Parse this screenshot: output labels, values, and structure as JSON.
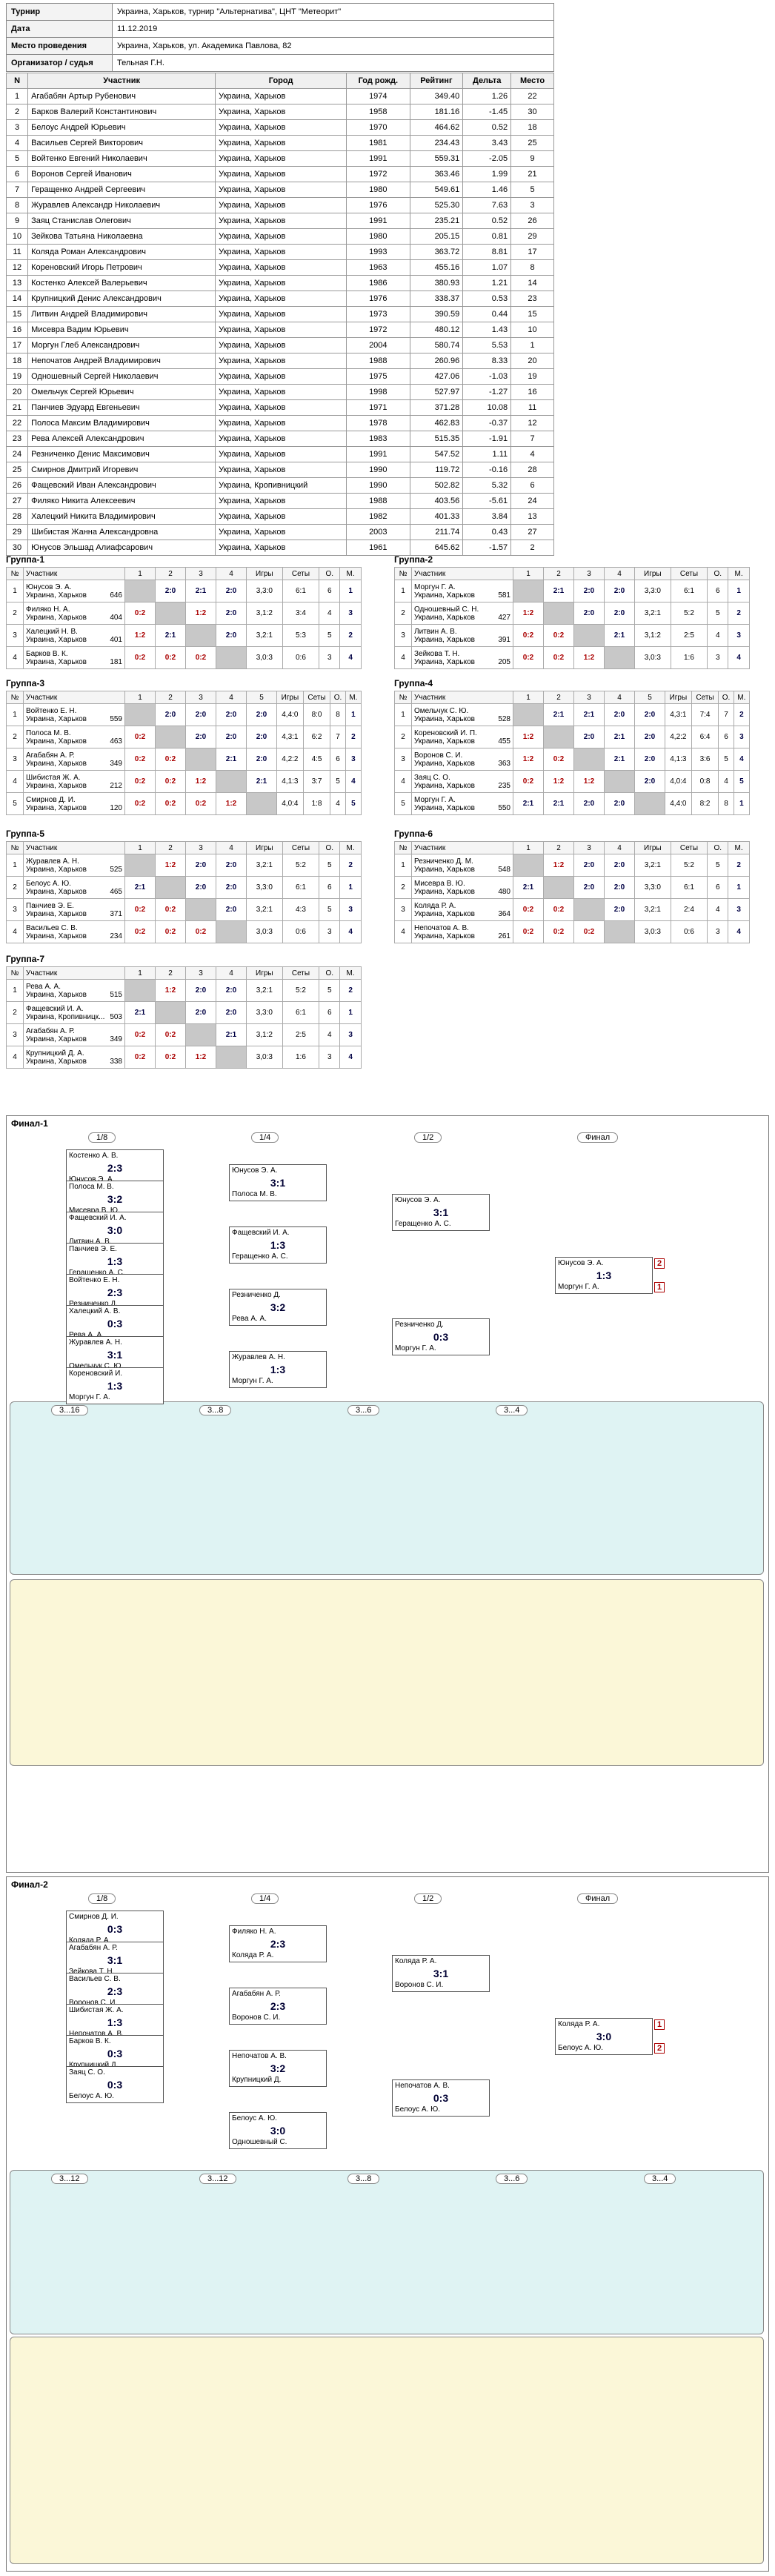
{
  "info": [
    [
      "Турнир",
      "Украина, Харьков, турнир \"Альтернатива\", ЦНТ \"Метеорит\""
    ],
    [
      "Дата",
      "11.12.2019"
    ],
    [
      "Место проведения",
      "Украина, Харьков, ул. Академика Павлова, 82"
    ],
    [
      "Организатор / судья",
      "Тельная Г.Н."
    ]
  ],
  "players_headers": [
    "N",
    "Участник",
    "Город",
    "Год рожд.",
    "Рейтинг",
    "Дельта",
    "Место"
  ],
  "players": [
    [
      "1",
      "Агабабян Артыр Рубенович",
      "Украина, Харьков",
      "1974",
      "349.40",
      "1.26",
      "22"
    ],
    [
      "2",
      "Барков Валерий Константинович",
      "Украина, Харьков",
      "1958",
      "181.16",
      "-1.45",
      "30"
    ],
    [
      "3",
      "Белоус Андрей Юрьевич",
      "Украина, Харьков",
      "1970",
      "464.62",
      "0.52",
      "18"
    ],
    [
      "4",
      "Васильев Сергей Викторович",
      "Украина, Харьков",
      "1981",
      "234.43",
      "3.43",
      "25"
    ],
    [
      "5",
      "Войтенко Евгений Николаевич",
      "Украина, Харьков",
      "1991",
      "559.31",
      "-2.05",
      "9"
    ],
    [
      "6",
      "Воронов Сергей Иванович",
      "Украина, Харьков",
      "1972",
      "363.46",
      "1.99",
      "21"
    ],
    [
      "7",
      "Геращенко Андрей Сергеевич",
      "Украина, Харьков",
      "1980",
      "549.61",
      "1.46",
      "5"
    ],
    [
      "8",
      "Журавлев Александр Николаевич",
      "Украина, Харьков",
      "1976",
      "525.30",
      "7.63",
      "3"
    ],
    [
      "9",
      "Заяц Станислав Олегович",
      "Украина, Харьков",
      "1991",
      "235.21",
      "0.52",
      "26"
    ],
    [
      "10",
      "Зейкова Татьяна Николаевна",
      "Украина, Харьков",
      "1980",
      "205.15",
      "0.81",
      "29"
    ],
    [
      "11",
      "Коляда Роман Александрович",
      "Украина, Харьков",
      "1993",
      "363.72",
      "8.81",
      "17"
    ],
    [
      "12",
      "Кореновский Игорь Петрович",
      "Украина, Харьков",
      "1963",
      "455.16",
      "1.07",
      "8"
    ],
    [
      "13",
      "Костенко Алексей Валерьевич",
      "Украина, Харьков",
      "1986",
      "380.93",
      "1.21",
      "14"
    ],
    [
      "14",
      "Крупницкий Денис Александрович",
      "Украина, Харьков",
      "1976",
      "338.37",
      "0.53",
      "23"
    ],
    [
      "15",
      "Литвин Андрей Владимирович",
      "Украина, Харьков",
      "1973",
      "390.59",
      "0.44",
      "15"
    ],
    [
      "16",
      "Мисевра Вадим Юрьевич",
      "Украина, Харьков",
      "1972",
      "480.12",
      "1.43",
      "10"
    ],
    [
      "17",
      "Моргун Глеб Александрович",
      "Украина, Харьков",
      "2004",
      "580.74",
      "5.53",
      "1"
    ],
    [
      "18",
      "Непочатов Андрей Владимирович",
      "Украина, Харьков",
      "1988",
      "260.96",
      "8.33",
      "20"
    ],
    [
      "19",
      "Одношевный Сергей Николаевич",
      "Украина, Харьков",
      "1975",
      "427.06",
      "-1.03",
      "19"
    ],
    [
      "20",
      "Омельчук Сергей Юрьевич",
      "Украина, Харьков",
      "1998",
      "527.97",
      "-1.27",
      "16"
    ],
    [
      "21",
      "Панчиев Эдуард Евгеньевич",
      "Украина, Харьков",
      "1971",
      "371.28",
      "10.08",
      "11"
    ],
    [
      "22",
      "Полоса Максим Владимирович",
      "Украина, Харьков",
      "1978",
      "462.83",
      "-0.37",
      "12"
    ],
    [
      "23",
      "Рева Алексей Александрович",
      "Украина, Харьков",
      "1983",
      "515.35",
      "-1.91",
      "7"
    ],
    [
      "24",
      "Резниченко Денис Максимович",
      "Украина, Харьков",
      "1991",
      "547.52",
      "1.11",
      "4"
    ],
    [
      "25",
      "Смирнов Дмитрий Игоревич",
      "Украина, Харьков",
      "1990",
      "119.72",
      "-0.16",
      "28"
    ],
    [
      "26",
      "Фащевский Иван Александрович",
      "Украина, Кропивницкий",
      "1990",
      "502.82",
      "5.32",
      "6"
    ],
    [
      "27",
      "Филяко Никита Алексеевич",
      "Украина, Харьков",
      "1988",
      "403.56",
      "-5.61",
      "24"
    ],
    [
      "28",
      "Халецкий Никита Владимирович",
      "Украина, Харьков",
      "1982",
      "401.33",
      "3.84",
      "13"
    ],
    [
      "29",
      "Шибистая Жанна Александровна",
      "Украина, Харьков",
      "2003",
      "211.74",
      "0.43",
      "27"
    ],
    [
      "30",
      "Юнусов Эльшад Алиафсарович",
      "Украина, Харьков",
      "1961",
      "645.62",
      "-1.57",
      "2"
    ]
  ],
  "group_headers": {
    "n": "№",
    "name": "Участник",
    "games": "Игры",
    "sets": "Сеты",
    "o": "О.",
    "m": "М."
  },
  "groups": [
    {
      "title": "Группа-1",
      "size": 4,
      "rows": [
        {
          "n": "1",
          "name": "Юнусов Э. А.",
          "city": "Украина, Харьков",
          "rating": "646",
          "scores": [
            "",
            "2:0",
            "2:1",
            "2:0"
          ],
          "games": "3,3:0",
          "sets": "6:1",
          "o": "6",
          "m": "1"
        },
        {
          "n": "2",
          "name": "Филяко Н. А.",
          "city": "Украина, Харьков",
          "rating": "404",
          "scores": [
            "0:2",
            "",
            "1:2",
            "2:0"
          ],
          "games": "3,1:2",
          "sets": "3:4",
          "o": "4",
          "m": "3"
        },
        {
          "n": "3",
          "name": "Халецкий Н. В.",
          "city": "Украина, Харьков",
          "rating": "401",
          "scores": [
            "1:2",
            "2:1",
            "",
            "2:0"
          ],
          "games": "3,2:1",
          "sets": "5:3",
          "o": "5",
          "m": "2"
        },
        {
          "n": "4",
          "name": "Барков В. К.",
          "city": "Украина, Харьков",
          "rating": "181",
          "scores": [
            "0:2",
            "0:2",
            "0:2",
            ""
          ],
          "games": "3,0:3",
          "sets": "0:6",
          "o": "3",
          "m": "4"
        }
      ]
    },
    {
      "title": "Группа-2",
      "size": 4,
      "rows": [
        {
          "n": "1",
          "name": "Моргун Г. А.",
          "city": "Украина, Харьков",
          "rating": "581",
          "scores": [
            "",
            "2:1",
            "2:0",
            "2:0"
          ],
          "games": "3,3:0",
          "sets": "6:1",
          "o": "6",
          "m": "1"
        },
        {
          "n": "2",
          "name": "Одношевный С. Н.",
          "city": "Украина, Харьков",
          "rating": "427",
          "scores": [
            "1:2",
            "",
            "2:0",
            "2:0"
          ],
          "games": "3,2:1",
          "sets": "5:2",
          "o": "5",
          "m": "2"
        },
        {
          "n": "3",
          "name": "Литвин А. В.",
          "city": "Украина, Харьков",
          "rating": "391",
          "scores": [
            "0:2",
            "0:2",
            "",
            "2:1"
          ],
          "games": "3,1:2",
          "sets": "2:5",
          "o": "4",
          "m": "3"
        },
        {
          "n": "4",
          "name": "Зейкова Т. Н.",
          "city": "Украина, Харьков",
          "rating": "205",
          "scores": [
            "0:2",
            "0:2",
            "1:2",
            ""
          ],
          "games": "3,0:3",
          "sets": "1:6",
          "o": "3",
          "m": "4"
        }
      ]
    },
    {
      "title": "Группа-3",
      "size": 5,
      "rows": [
        {
          "n": "1",
          "name": "Войтенко Е. Н.",
          "city": "Украина, Харьков",
          "rating": "559",
          "scores": [
            "",
            "2:0",
            "2:0",
            "2:0",
            "2:0"
          ],
          "games": "4,4:0",
          "sets": "8:0",
          "o": "8",
          "m": "1"
        },
        {
          "n": "2",
          "name": "Полоса М. В.",
          "city": "Украина, Харьков",
          "rating": "463",
          "scores": [
            "0:2",
            "",
            "2:0",
            "2:0",
            "2:0"
          ],
          "games": "4,3:1",
          "sets": "6:2",
          "o": "7",
          "m": "2"
        },
        {
          "n": "3",
          "name": "Агабабян А. Р.",
          "city": "Украина, Харьков",
          "rating": "349",
          "scores": [
            "0:2",
            "0:2",
            "",
            "2:1",
            "2:0"
          ],
          "games": "4,2:2",
          "sets": "4:5",
          "o": "6",
          "m": "3"
        },
        {
          "n": "4",
          "name": "Шибистая Ж. А.",
          "city": "Украина, Харьков",
          "rating": "212",
          "scores": [
            "0:2",
            "0:2",
            "1:2",
            "",
            "2:1"
          ],
          "games": "4,1:3",
          "sets": "3:7",
          "o": "5",
          "m": "4"
        },
        {
          "n": "5",
          "name": "Смирнов Д. И.",
          "city": "Украина, Харьков",
          "rating": "120",
          "scores": [
            "0:2",
            "0:2",
            "0:2",
            "1:2",
            ""
          ],
          "games": "4,0:4",
          "sets": "1:8",
          "o": "4",
          "m": "5"
        }
      ]
    },
    {
      "title": "Группа-4",
      "size": 5,
      "rows": [
        {
          "n": "1",
          "name": "Омельчук С. Ю.",
          "city": "Украина, Харьков",
          "rating": "528",
          "scores": [
            "",
            "2:1",
            "2:1",
            "2:0",
            "2:0"
          ],
          "games": "4,3:1",
          "sets": "7:4",
          "o": "7",
          "m": "2"
        },
        {
          "n": "2",
          "name": "Кореновский И. П.",
          "city": "Украина, Харьков",
          "rating": "455",
          "scores": [
            "1:2",
            "",
            "2:0",
            "2:1",
            "2:0"
          ],
          "games": "4,2:2",
          "sets": "6:4",
          "o": "6",
          "m": "3"
        },
        {
          "n": "3",
          "name": "Воронов С. И.",
          "city": "Украина, Харьков",
          "rating": "363",
          "scores": [
            "1:2",
            "0:2",
            "",
            "2:1",
            "2:0"
          ],
          "games": "4,1:3",
          "sets": "3:6",
          "o": "5",
          "m": "4"
        },
        {
          "n": "4",
          "name": "Заяц С. О.",
          "city": "Украина, Харьков",
          "rating": "235",
          "scores": [
            "0:2",
            "1:2",
            "1:2",
            "",
            "2:0"
          ],
          "games": "4,0:4",
          "sets": "0:8",
          "o": "4",
          "m": "5"
        },
        {
          "n": "5",
          "name": "Моргун Г. А.",
          "city": "Украина, Харьков",
          "rating": "550",
          "scores": [
            "2:1",
            "2:1",
            "2:0",
            "2:0",
            ""
          ],
          "games": "4,4:0",
          "sets": "8:2",
          "o": "8",
          "m": "1"
        }
      ]
    },
    {
      "title": "Группа-5",
      "size": 4,
      "rows": [
        {
          "n": "1",
          "name": "Журавлев А. Н.",
          "city": "Украина, Харьков",
          "rating": "525",
          "scores": [
            "",
            "1:2",
            "2:0",
            "2:0"
          ],
          "games": "3,2:1",
          "sets": "5:2",
          "o": "5",
          "m": "2"
        },
        {
          "n": "2",
          "name": "Белоус А. Ю.",
          "city": "Украина, Харьков",
          "rating": "465",
          "scores": [
            "2:1",
            "",
            "2:0",
            "2:0"
          ],
          "games": "3,3:0",
          "sets": "6:1",
          "o": "6",
          "m": "1"
        },
        {
          "n": "3",
          "name": "Панчиев Э. Е.",
          "city": "Украина, Харьков",
          "rating": "371",
          "scores": [
            "0:2",
            "0:2",
            "",
            "2:0"
          ],
          "games": "3,2:1",
          "sets": "4:3",
          "o": "5",
          "m": "3"
        },
        {
          "n": "4",
          "name": "Васильев С. В.",
          "city": "Украина, Харьков",
          "rating": "234",
          "scores": [
            "0:2",
            "0:2",
            "0:2",
            ""
          ],
          "games": "3,0:3",
          "sets": "0:6",
          "o": "3",
          "m": "4"
        }
      ]
    },
    {
      "title": "Группа-6",
      "size": 4,
      "rows": [
        {
          "n": "1",
          "name": "Резниченко Д. М.",
          "city": "Украина, Харьков",
          "rating": "548",
          "scores": [
            "",
            "1:2",
            "2:0",
            "2:0"
          ],
          "games": "3,2:1",
          "sets": "5:2",
          "o": "5",
          "m": "2"
        },
        {
          "n": "2",
          "name": "Мисевра В. Ю.",
          "city": "Украина, Харьков",
          "rating": "480",
          "scores": [
            "2:1",
            "",
            "2:0",
            "2:0"
          ],
          "games": "3,3:0",
          "sets": "6:1",
          "o": "6",
          "m": "1"
        },
        {
          "n": "3",
          "name": "Коляда Р. А.",
          "city": "Украина, Харьков",
          "rating": "364",
          "scores": [
            "0:2",
            "0:2",
            "",
            "2:0"
          ],
          "games": "3,2:1",
          "sets": "2:4",
          "o": "4",
          "m": "3"
        },
        {
          "n": "4",
          "name": "Непочатов А. В.",
          "city": "Украина, Харьков",
          "rating": "261",
          "scores": [
            "0:2",
            "0:2",
            "0:2",
            ""
          ],
          "games": "3,0:3",
          "sets": "0:6",
          "o": "3",
          "m": "4"
        }
      ]
    },
    {
      "title": "Группа-7",
      "size": 4,
      "rows": [
        {
          "n": "1",
          "name": "Рева А. А.",
          "city": "Украина, Харьков",
          "rating": "515",
          "scores": [
            "",
            "1:2",
            "2:0",
            "2:0"
          ],
          "games": "3,2:1",
          "sets": "5:2",
          "o": "5",
          "m": "2"
        },
        {
          "n": "2",
          "name": "Фащевский И. А.",
          "city": "Украина, Кропивницк...",
          "rating": "503",
          "scores": [
            "2:1",
            "",
            "2:0",
            "2:0"
          ],
          "games": "3,3:0",
          "sets": "6:1",
          "o": "6",
          "m": "1"
        },
        {
          "n": "3",
          "name": "Агабабян А. Р.",
          "city": "Украина, Харьков",
          "rating": "349",
          "scores": [
            "0:2",
            "0:2",
            "",
            "2:1"
          ],
          "games": "3,1:2",
          "sets": "2:5",
          "o": "4",
          "m": "3"
        },
        {
          "n": "4",
          "name": "Крупницкий Д. А.",
          "city": "Украина, Харьков",
          "rating": "338",
          "scores": [
            "0:2",
            "0:2",
            "1:2",
            ""
          ],
          "games": "3,0:3",
          "sets": "1:6",
          "o": "3",
          "m": "4"
        }
      ]
    }
  ],
  "final1": {
    "title": "Финал-1",
    "rounds": [
      "1/8",
      "1/4",
      "1/2",
      "Финал"
    ],
    "r8": [
      {
        "a": "Костенко А. В.",
        "b": "Юнусов Э. А.",
        "s": "2:3"
      },
      {
        "a": "Полоса М. В.",
        "b": "Мисевра В. Ю.",
        "s": "3:2"
      },
      {
        "a": "Фащевский И. А.",
        "b": "Литвин А. В.",
        "s": "3:0"
      },
      {
        "a": "Панчиев Э. Е.",
        "b": "Геращенко А. С.",
        "s": "1:3"
      },
      {
        "a": "Войтенко Е. Н.",
        "b": "Резниченко Д.",
        "s": "2:3"
      },
      {
        "a": "Халецкий А. В.",
        "b": "Рева А. А.",
        "s": "0:3"
      },
      {
        "a": "Журавлев А. Н.",
        "b": "Омельчук С. Ю.",
        "s": "3:1"
      },
      {
        "a": "Кореновский И.",
        "b": "Моргун Г. А.",
        "s": "1:3"
      }
    ],
    "r4": [
      {
        "a": "Юнусов Э. А.",
        "b": "Полоса М. В.",
        "s": "3:1"
      },
      {
        "a": "Фащевский И. А.",
        "b": "Геращенко А. С.",
        "s": "1:3"
      },
      {
        "a": "Резниченко Д.",
        "b": "Рева А. А.",
        "s": "3:2"
      },
      {
        "a": "Журавлев А. Н.",
        "b": "Моргун Г. А.",
        "s": "1:3"
      }
    ],
    "r2": [
      {
        "a": "Юнусов Э. А.",
        "b": "Геращенко А. С.",
        "s": "3:1"
      },
      {
        "a": "Резниченко Д.",
        "b": "Моргун Г. А.",
        "s": "0:3"
      }
    ],
    "fin": {
      "a": "Юнусов Э. А.",
      "b": "Моргун Г. А.",
      "s": "1:3",
      "pa": "2",
      "pb": "1"
    },
    "cons_titles": [
      "3...16",
      "3...8",
      "3...6",
      "3...4"
    ]
  },
  "final2": {
    "title": "Финал-2",
    "rounds": [
      "1/8",
      "1/4",
      "1/2",
      "Финал"
    ],
    "r8": [
      {
        "a": "Смирнов Д. И.",
        "b": "Коляда Р. А.",
        "s": "0:3"
      },
      {
        "a": "Агабабян А. Р.",
        "b": "Зейкова Т. Н.",
        "s": "3:1"
      },
      {
        "a": "Васильев С. В.",
        "b": "Воронов С. И.",
        "s": "2:3"
      },
      {
        "a": "Шибистая Ж. А.",
        "b": "Непочатов А. В.",
        "s": "1:3"
      },
      {
        "a": "Барков В. К.",
        "b": "Крупницкий Д.",
        "s": "0:3"
      },
      {
        "a": "Заяц С. О.",
        "b": "Белоус А. Ю.",
        "s": "0:3"
      }
    ],
    "r4": [
      {
        "a": "Филяко Н. А.",
        "b": "Коляда Р. А.",
        "s": "2:3"
      },
      {
        "a": "Агабабян А. Р.",
        "b": "Воронов С. И.",
        "s": "2:3"
      },
      {
        "a": "Непочатов А. В.",
        "b": "Крупницкий Д.",
        "s": "3:2"
      },
      {
        "a": "Белоус А. Ю.",
        "b": "Одношевный С.",
        "s": "3:0"
      }
    ],
    "r2": [
      {
        "a": "Коляда Р. А.",
        "b": "Воронов С. И.",
        "s": "3:1"
      },
      {
        "a": "Непочатов А. В.",
        "b": "Белоус А. Ю.",
        "s": "0:3"
      }
    ],
    "fin": {
      "a": "Коляда Р. А.",
      "b": "Белоус А. Ю.",
      "s": "3:0",
      "pa": "1",
      "pb": "2"
    },
    "cons_titles": [
      "3...12",
      "3...12",
      "3...8",
      "3...6",
      "3...4"
    ]
  }
}
